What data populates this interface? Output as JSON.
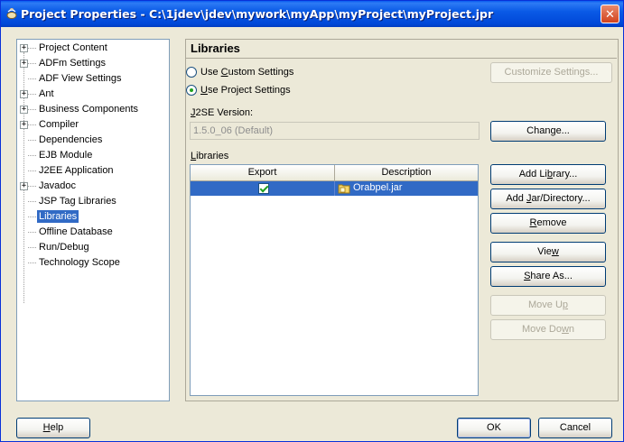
{
  "window": {
    "title": "Project Properties - C:\\1jdev\\jdev\\mywork\\myApp\\myProject\\myProject.jpr",
    "close_glyph": "✕"
  },
  "tree": {
    "items": [
      {
        "label": "Project Content",
        "expandable": true,
        "selected": false
      },
      {
        "label": "ADFm Settings",
        "expandable": true,
        "selected": false
      },
      {
        "label": "ADF View Settings",
        "expandable": false,
        "selected": false
      },
      {
        "label": "Ant",
        "expandable": true,
        "selected": false
      },
      {
        "label": "Business Components",
        "expandable": true,
        "selected": false
      },
      {
        "label": "Compiler",
        "expandable": true,
        "selected": false
      },
      {
        "label": "Dependencies",
        "expandable": false,
        "selected": false
      },
      {
        "label": "EJB Module",
        "expandable": false,
        "selected": false
      },
      {
        "label": "J2EE Application",
        "expandable": false,
        "selected": false
      },
      {
        "label": "Javadoc",
        "expandable": true,
        "selected": false
      },
      {
        "label": "JSP Tag Libraries",
        "expandable": false,
        "selected": false
      },
      {
        "label": "Libraries",
        "expandable": false,
        "selected": true
      },
      {
        "label": "Offline Database",
        "expandable": false,
        "selected": false
      },
      {
        "label": "Run/Debug",
        "expandable": false,
        "selected": false
      },
      {
        "label": "Technology Scope",
        "expandable": false,
        "selected": false
      }
    ]
  },
  "panel": {
    "heading": "Libraries",
    "radio_custom": {
      "pre": "Use ",
      "ul": "C",
      "post": "ustom Settings",
      "selected": false
    },
    "radio_project": {
      "pre": "",
      "ul": "U",
      "post": "se Project Settings",
      "selected": true
    },
    "customize_button": "Customize Settings...",
    "j2se_label": {
      "ul": "J",
      "post": "2SE Version:"
    },
    "j2se_value": "1.5.0_06 (Default)",
    "change_button": {
      "pre": "Chan",
      "ul": "g",
      "post": "e..."
    },
    "libraries_label": {
      "ul": "L",
      "post": "ibraries"
    },
    "table": {
      "columns": [
        "Export",
        "Description"
      ],
      "rows": [
        {
          "export": true,
          "description": "Orabpel.jar"
        }
      ]
    },
    "buttons": {
      "add_library": {
        "pre": "Add Li",
        "ul": "b",
        "post": "rary..."
      },
      "add_jar": {
        "pre": "Add ",
        "ul": "J",
        "post": "ar/Directory..."
      },
      "remove": {
        "pre": "",
        "ul": "R",
        "post": "emove"
      },
      "view": {
        "pre": "Vie",
        "ul": "w",
        "post": ""
      },
      "share_as": {
        "pre": "",
        "ul": "S",
        "post": "hare As..."
      },
      "move_up": {
        "pre": "Move U",
        "ul": "p",
        "post": ""
      },
      "move_down": {
        "pre": "Move Do",
        "ul": "w",
        "post": "n"
      }
    }
  },
  "footer": {
    "help": {
      "ul": "H",
      "post": "elp"
    },
    "ok": "OK",
    "cancel": "Cancel"
  },
  "colors": {
    "titlebar": "#0a5ae6",
    "selection": "#316ac5",
    "window_bg": "#ece9d8"
  }
}
